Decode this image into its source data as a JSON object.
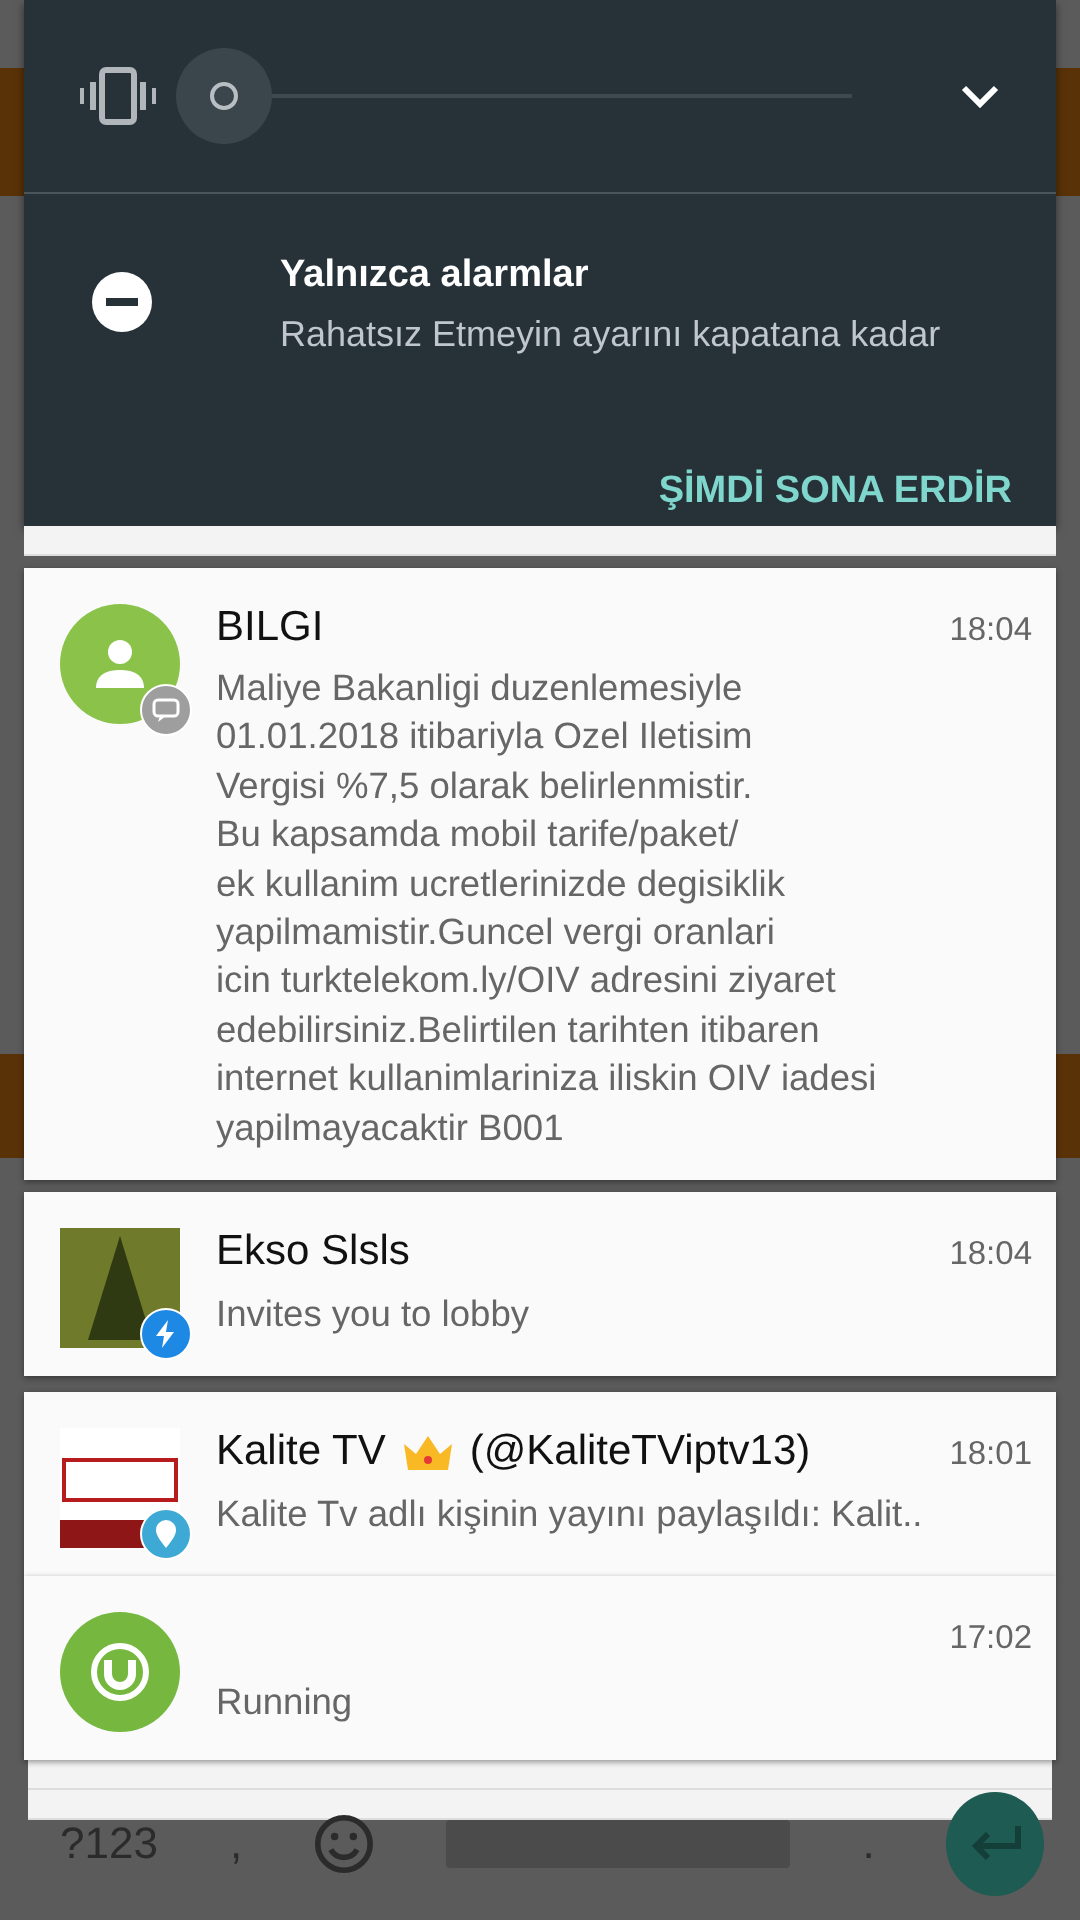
{
  "volume": {
    "level": 0
  },
  "dnd": {
    "title": "Yalnızca alarmlar",
    "subtitle": "Rahatsız Etmeyin ayarını kapatana kadar",
    "action": "ŞİMDİ SONA ERDİR"
  },
  "notifications": [
    {
      "kind": "contact",
      "badge": {
        "kind": "message"
      },
      "title": "BILGI",
      "time": "18:04",
      "body": "Maliye Bakanligi duzenlemesiyle\n01.01.2018 itibariyla Ozel Iletisim\nVergisi %7,5 olarak belirlenmistir.\nBu kapsamda mobil tarife/paket/\nek kullanim ucretlerinizde degisiklik\nyapilmamistir.Guncel vergi oranlari\nicin turktelekom.ly/OIV adresini ziyaret\nedebilirsiniz.Belirtilen tarihten itibaren\ninternet kullanimlariniza iliskin OIV iadesi\nyapilmayacaktir B001"
    },
    {
      "kind": "photo",
      "badge": {
        "kind": "bolt"
      },
      "title": "Ekso Slsls",
      "time": "18:04",
      "body": "Invites you to lobby"
    },
    {
      "kind": "logo",
      "badge": {
        "kind": "pin"
      },
      "title": "Kalite TV",
      "handle": "(@KaliteTViptv13)",
      "time": "18:01",
      "body": "Kalite Tv adlı kişinin yayını paylaşıldı: Kalit.."
    },
    {
      "kind": "torrent",
      "time": "17:02",
      "body": "Running"
    }
  ],
  "keyboard": {
    "symbols": "?123",
    "comma": ",",
    "period": "."
  }
}
